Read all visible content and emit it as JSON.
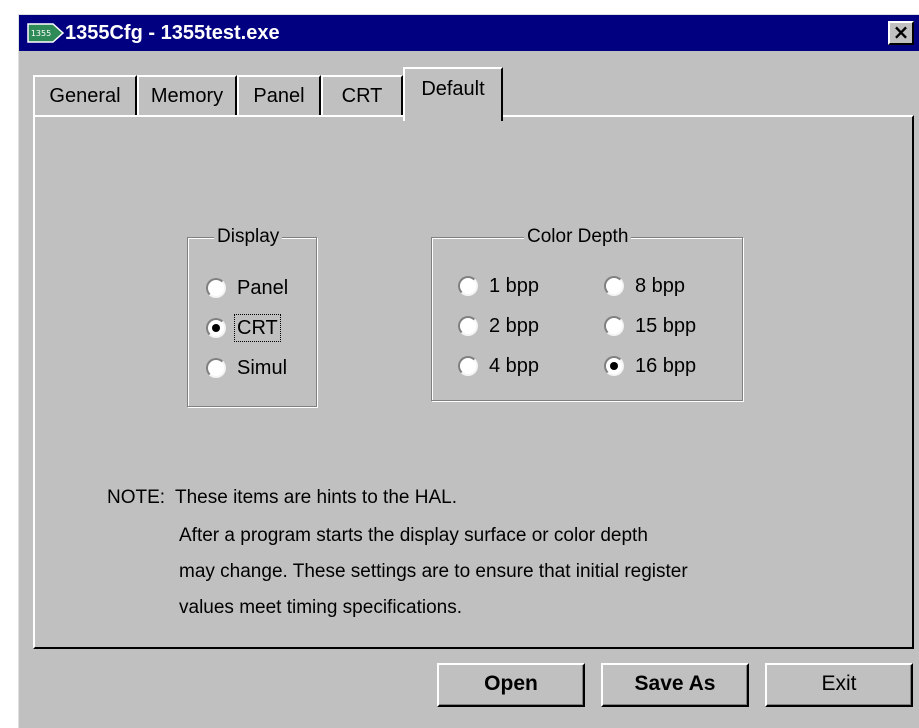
{
  "window": {
    "title": "1355Cfg - 1355test.exe",
    "icon_text": "1355",
    "icon": "app-logo-icon",
    "close_glyph": "×",
    "accent_color": "#000080"
  },
  "tabs": [
    {
      "label": "General",
      "active": false
    },
    {
      "label": "Memory",
      "active": false
    },
    {
      "label": "Panel",
      "active": false
    },
    {
      "label": "CRT",
      "active": false
    },
    {
      "label": "Default",
      "active": true
    }
  ],
  "display_group": {
    "title": "Display",
    "options": [
      {
        "label": "Panel",
        "selected": false
      },
      {
        "label": "CRT",
        "selected": true
      },
      {
        "label": "Simul",
        "selected": false
      }
    ]
  },
  "color_depth_group": {
    "title": "Color Depth",
    "options": [
      {
        "label": "1 bpp",
        "selected": false
      },
      {
        "label": "2 bpp",
        "selected": false
      },
      {
        "label": "4 bpp",
        "selected": false
      },
      {
        "label": "8 bpp",
        "selected": false
      },
      {
        "label": "15 bpp",
        "selected": false
      },
      {
        "label": "16 bpp",
        "selected": true
      }
    ]
  },
  "note": {
    "prefix": "NOTE:",
    "lines": [
      "These items are hints to the HAL.",
      "After a program starts the display surface or color depth",
      "may change. These settings are to ensure that initial register",
      "values meet timing specifications."
    ]
  },
  "buttons": {
    "open": "Open",
    "save_as": "Save As",
    "exit": "Exit"
  }
}
